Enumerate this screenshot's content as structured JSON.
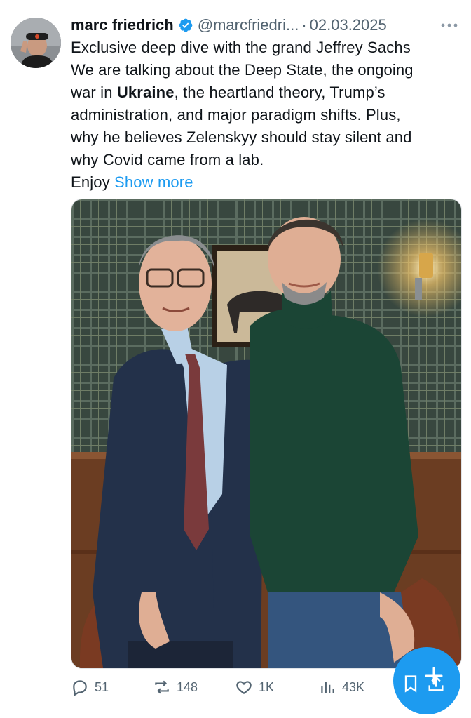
{
  "author": {
    "name": "marc friedrich",
    "handle": "@marcfriedri...",
    "separator": "·",
    "date": "02.03.2025",
    "verified": true
  },
  "tweet": {
    "lines": [
      "Exclusive deep dive with the grand Jeffrey Sachs",
      "We are talking about the Deep State, the ongoing",
      "war in ",
      "Ukraine",
      ", the heartland theory, Trump’s",
      "administration, and major paradigm shifts. Plus,",
      "why he believes Zelenskyy should stay silent and",
      "why Covid came from a lab.",
      "Enjoy "
    ],
    "show_more": "Show more"
  },
  "actions": {
    "replies": "51",
    "reposts": "148",
    "likes": "1K",
    "views": "43K"
  },
  "icons": {
    "more": "ellipsis-icon",
    "reply": "reply-icon",
    "repost": "repost-icon",
    "like": "heart-icon",
    "views": "views-icon",
    "bookmark": "bookmark-icon",
    "share": "share-icon",
    "compose": "compose-icon"
  },
  "colors": {
    "accent": "#1d9bf0",
    "muted": "#536471",
    "text": "#0f1419"
  }
}
